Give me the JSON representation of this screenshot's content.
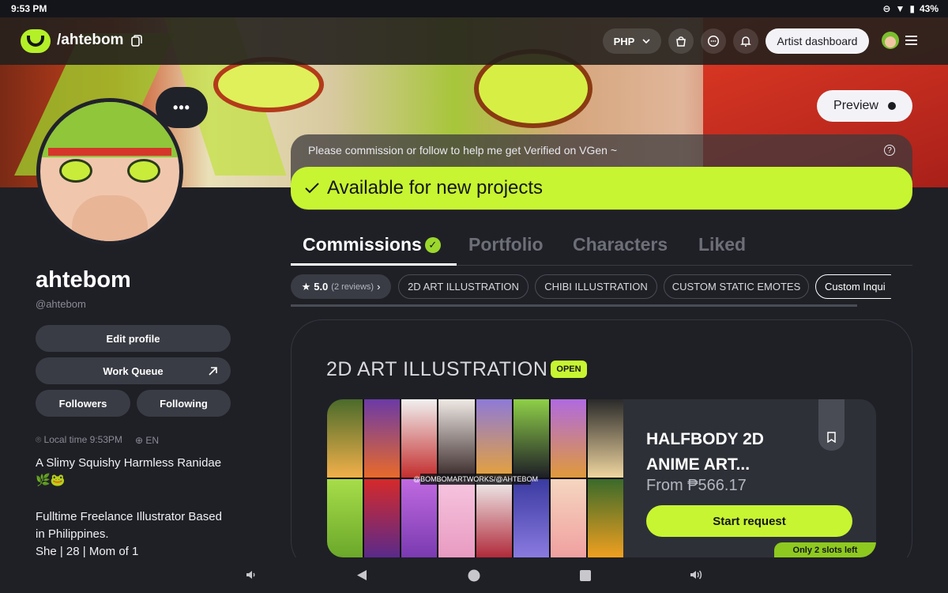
{
  "status_bar": {
    "time": "9:53 PM",
    "battery": "43%"
  },
  "header": {
    "handle": "/ahtebom",
    "currency": "PHP",
    "artist_dashboard": "Artist dashboard"
  },
  "banner": {
    "preview_label": "Preview"
  },
  "profile": {
    "name": "ahtebom",
    "handle": "@ahtebom",
    "edit_profile": "Edit profile",
    "work_queue": "Work Queue",
    "followers": "Followers",
    "following": "Following",
    "local_time": "Local time 9:53PM",
    "language": "EN",
    "bio_line1": "A Slimy Squishy Harmless Ranidae",
    "bio_emoji": "🌿🐸",
    "bio_line3": "Fulltime Freelance Illustrator Based",
    "bio_line4": "in Philippines.",
    "bio_line5": "She | 28 | Mom of 1"
  },
  "availability": {
    "verify_note": "Please commission or follow to help me get Verified on VGen ~",
    "status": "Available for new projects"
  },
  "tabs": {
    "commissions": "Commissions",
    "portfolio": "Portfolio",
    "characters": "Characters",
    "liked": "Liked"
  },
  "chips": {
    "rating": "5.0",
    "reviews": "(2 reviews)",
    "c1": "2D ART ILLUSTRATION",
    "c2": "CHIBI ILLUSTRATION",
    "c3": "CUSTOM STATIC EMOTES",
    "c4": "Custom Inqui"
  },
  "service": {
    "section_title": "2D ART ILLUSTRATION",
    "status_badge": "OPEN",
    "offer_title_1": "HALFBODY 2D",
    "offer_title_2": "ANIME ART...",
    "price": "From ₱566.17",
    "start_request": "Start request",
    "slots": "Only 2 slots left",
    "watermark": "@BOMBOMARTWORKS/@AHTEBOM"
  },
  "colors": {
    "accent": "#c7f531",
    "background": "#1f2026",
    "button": "#3a3c45"
  }
}
